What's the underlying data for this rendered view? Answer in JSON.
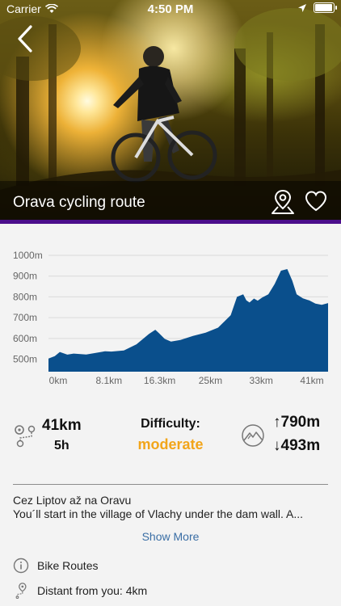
{
  "status_bar": {
    "carrier": "Carrier",
    "time": "4:50 PM"
  },
  "header": {
    "title": "Orava cycling route",
    "accent_color": "#4b0e8b"
  },
  "chart_data": {
    "type": "area",
    "title": "",
    "xlabel": "",
    "ylabel": "",
    "ylim": [
      440,
      1000
    ],
    "xlim": [
      0,
      44.5
    ],
    "y_ticks": [
      "1000m",
      "900m",
      "800m",
      "700m",
      "600m",
      "500m"
    ],
    "x_ticks": [
      "0km",
      "8.1km",
      "16.3km",
      "25km",
      "33km",
      "41km"
    ],
    "grid": true,
    "color": "#0a4f8c",
    "x": [
      0,
      1,
      1.8,
      3,
      4,
      6,
      8,
      9,
      10,
      12,
      14,
      16,
      17,
      17.6,
      18.5,
      19.5,
      21,
      23,
      25,
      27,
      29,
      30,
      31,
      31.5,
      32,
      32.7,
      33.3,
      34,
      35,
      36,
      37,
      38,
      38.8,
      39.5,
      40.5,
      41.5,
      42.5,
      43.5,
      44.5
    ],
    "values": [
      503,
      515,
      535,
      522,
      527,
      523,
      533,
      538,
      537,
      542,
      572,
      622,
      642,
      625,
      598,
      585,
      593,
      612,
      628,
      652,
      712,
      800,
      812,
      783,
      773,
      792,
      782,
      797,
      812,
      862,
      926,
      934,
      878,
      812,
      793,
      783,
      768,
      762,
      770
    ]
  },
  "stats": {
    "distance": "41km",
    "duration": "5h",
    "difficulty_label": "Difficulty:",
    "difficulty_value": "moderate",
    "difficulty_color": "#f2a51a",
    "ascent": "↑790m",
    "descent": "↓493m"
  },
  "description": {
    "title": "Cez Liptov až na Oravu",
    "text": "You´ll start in the village of Vlachy under the dam wall. A...",
    "show_more": "Show More"
  },
  "info": {
    "category": "Bike Routes",
    "distance_from_you": "Distant from you: 4km"
  }
}
